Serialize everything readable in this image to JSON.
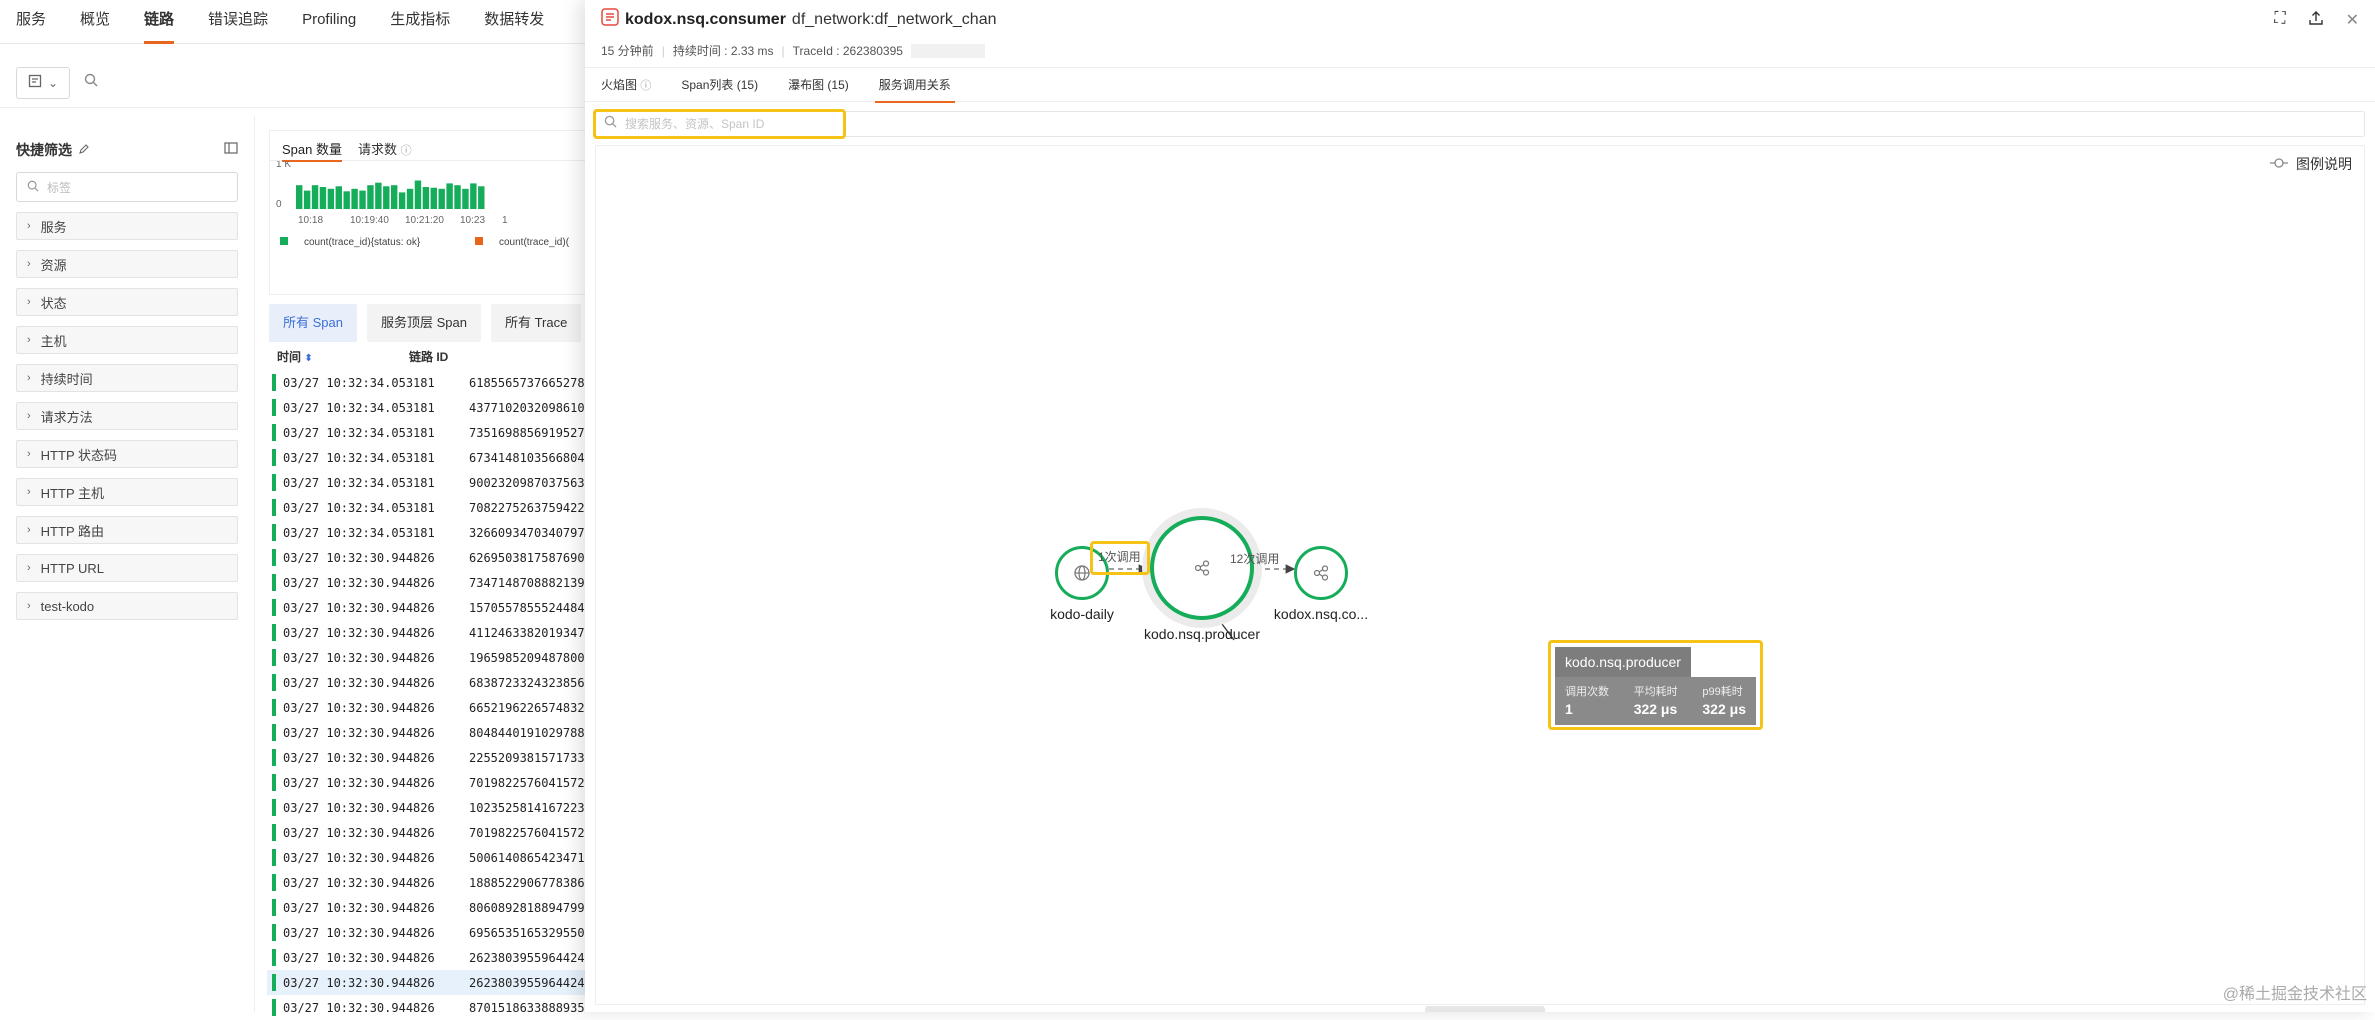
{
  "nav": {
    "tabs": [
      "服务",
      "概览",
      "链路",
      "错误追踪",
      "Profiling",
      "生成指标",
      "数据转发"
    ],
    "active_index": 2
  },
  "sidebar": {
    "title": "快捷筛选",
    "tag_search_placeholder": "标签",
    "facets": [
      "服务",
      "资源",
      "状态",
      "主机",
      "持续时间",
      "请求方法",
      "HTTP 状态码",
      "HTTP 主机",
      "HTTP 路由",
      "HTTP URL",
      "test-kodo"
    ]
  },
  "chart": {
    "tabs": [
      "Span 数量",
      "请求数"
    ],
    "y_ticks": [
      "1 K",
      "0"
    ],
    "x_ticks": [
      "10:18",
      "10:19:40",
      "10:21:20",
      "10:23",
      "1"
    ],
    "legend": [
      "count(trace_id){status: ok}",
      "count(trace_id)("
    ],
    "colors": {
      "ok": "#15ac5a",
      "error": "#e8661e"
    }
  },
  "chart_data": {
    "type": "bar",
    "title": "",
    "xlabel": "",
    "ylabel": "",
    "series": [
      {
        "name": "count(trace_id){status: ok}",
        "values": [
          0.55,
          0.4,
          0.55,
          0.5,
          0.45,
          0.52,
          0.38,
          0.45,
          0.4,
          0.55,
          0.62,
          0.52,
          0.55,
          0.35,
          0.45,
          0.68,
          0.5,
          0.48,
          0.45,
          0.6,
          0.55,
          0.45,
          0.6,
          0.52
        ]
      }
    ],
    "y_unit": "K",
    "ylim": [
      0,
      1
    ]
  },
  "span_tabs": [
    "所有 Span",
    "服务顶层 Span",
    "所有 Trace"
  ],
  "table": {
    "headers": [
      "时间",
      "链路 ID"
    ],
    "rows": [
      [
        "03/27 10:32:34.053181",
        "6185565737665278"
      ],
      [
        "03/27 10:32:34.053181",
        "4377102032098610"
      ],
      [
        "03/27 10:32:34.053181",
        "7351698856919527"
      ],
      [
        "03/27 10:32:34.053181",
        "6734148103566804"
      ],
      [
        "03/27 10:32:34.053181",
        "9002320987037563"
      ],
      [
        "03/27 10:32:34.053181",
        "7082275263759422"
      ],
      [
        "03/27 10:32:34.053181",
        "3266093470340797"
      ],
      [
        "03/27 10:32:30.944826",
        "6269503817587690"
      ],
      [
        "03/27 10:32:30.944826",
        "7347148708882139"
      ],
      [
        "03/27 10:32:30.944826",
        "1570557855524484"
      ],
      [
        "03/27 10:32:30.944826",
        "4112463382019347"
      ],
      [
        "03/27 10:32:30.944826",
        "1965985209487800"
      ],
      [
        "03/27 10:32:30.944826",
        "6838723324323856"
      ],
      [
        "03/27 10:32:30.944826",
        "6652196226574832"
      ],
      [
        "03/27 10:32:30.944826",
        "8048440191029788"
      ],
      [
        "03/27 10:32:30.944826",
        "2255209381571733"
      ],
      [
        "03/27 10:32:30.944826",
        "7019822576041572"
      ],
      [
        "03/27 10:32:30.944826",
        "1023525814167223"
      ],
      [
        "03/27 10:32:30.944826",
        "7019822576041572"
      ],
      [
        "03/27 10:32:30.944826",
        "5006140865423471"
      ],
      [
        "03/27 10:32:30.944826",
        "1888522906778386"
      ],
      [
        "03/27 10:32:30.944826",
        "8060892818894799"
      ],
      [
        "03/27 10:32:30.944826",
        "6956535165329550"
      ],
      [
        "03/27 10:32:30.944826",
        "2623803955964424"
      ],
      [
        "03/27 10:32:30.944826",
        "2623803955964424"
      ],
      [
        "03/27 10:32:30.944826",
        "8701518633888935"
      ]
    ],
    "highlight_index": 24
  },
  "drawer": {
    "service": "kodox.nsq.consumer",
    "resource": "df_network:df_network_chan",
    "time_ago": "15 分钟前",
    "duration": "持续时间 : 2.33 ms",
    "trace_id": "TraceId : 262380395",
    "tabs": [
      "火焰图",
      "Span列表 (15)",
      "瀑布图 (15)",
      "服务调用关系"
    ],
    "active_tab": 3,
    "search_placeholder": "搜索服务、资源、Span ID",
    "legend_label": "图例说明"
  },
  "graph": {
    "nodes": [
      {
        "name": "kodo-daily",
        "icon": "globe-icon"
      },
      {
        "name": "kodo.nsq.producer",
        "icon": "service-icon"
      },
      {
        "name": "kodox.nsq.co...",
        "icon": "service-icon"
      }
    ],
    "edges": [
      {
        "label": "1次调用"
      },
      {
        "label": "12次调用"
      }
    ],
    "tooltip": {
      "title": "kodo.nsq.producer",
      "metrics": [
        {
          "key": "调用次数",
          "value": "1"
        },
        {
          "key": "平均耗时",
          "value": "322 μs"
        },
        {
          "key": "p99耗时",
          "value": "322 μs"
        }
      ]
    }
  },
  "watermark": "@稀土掘金技术社区"
}
